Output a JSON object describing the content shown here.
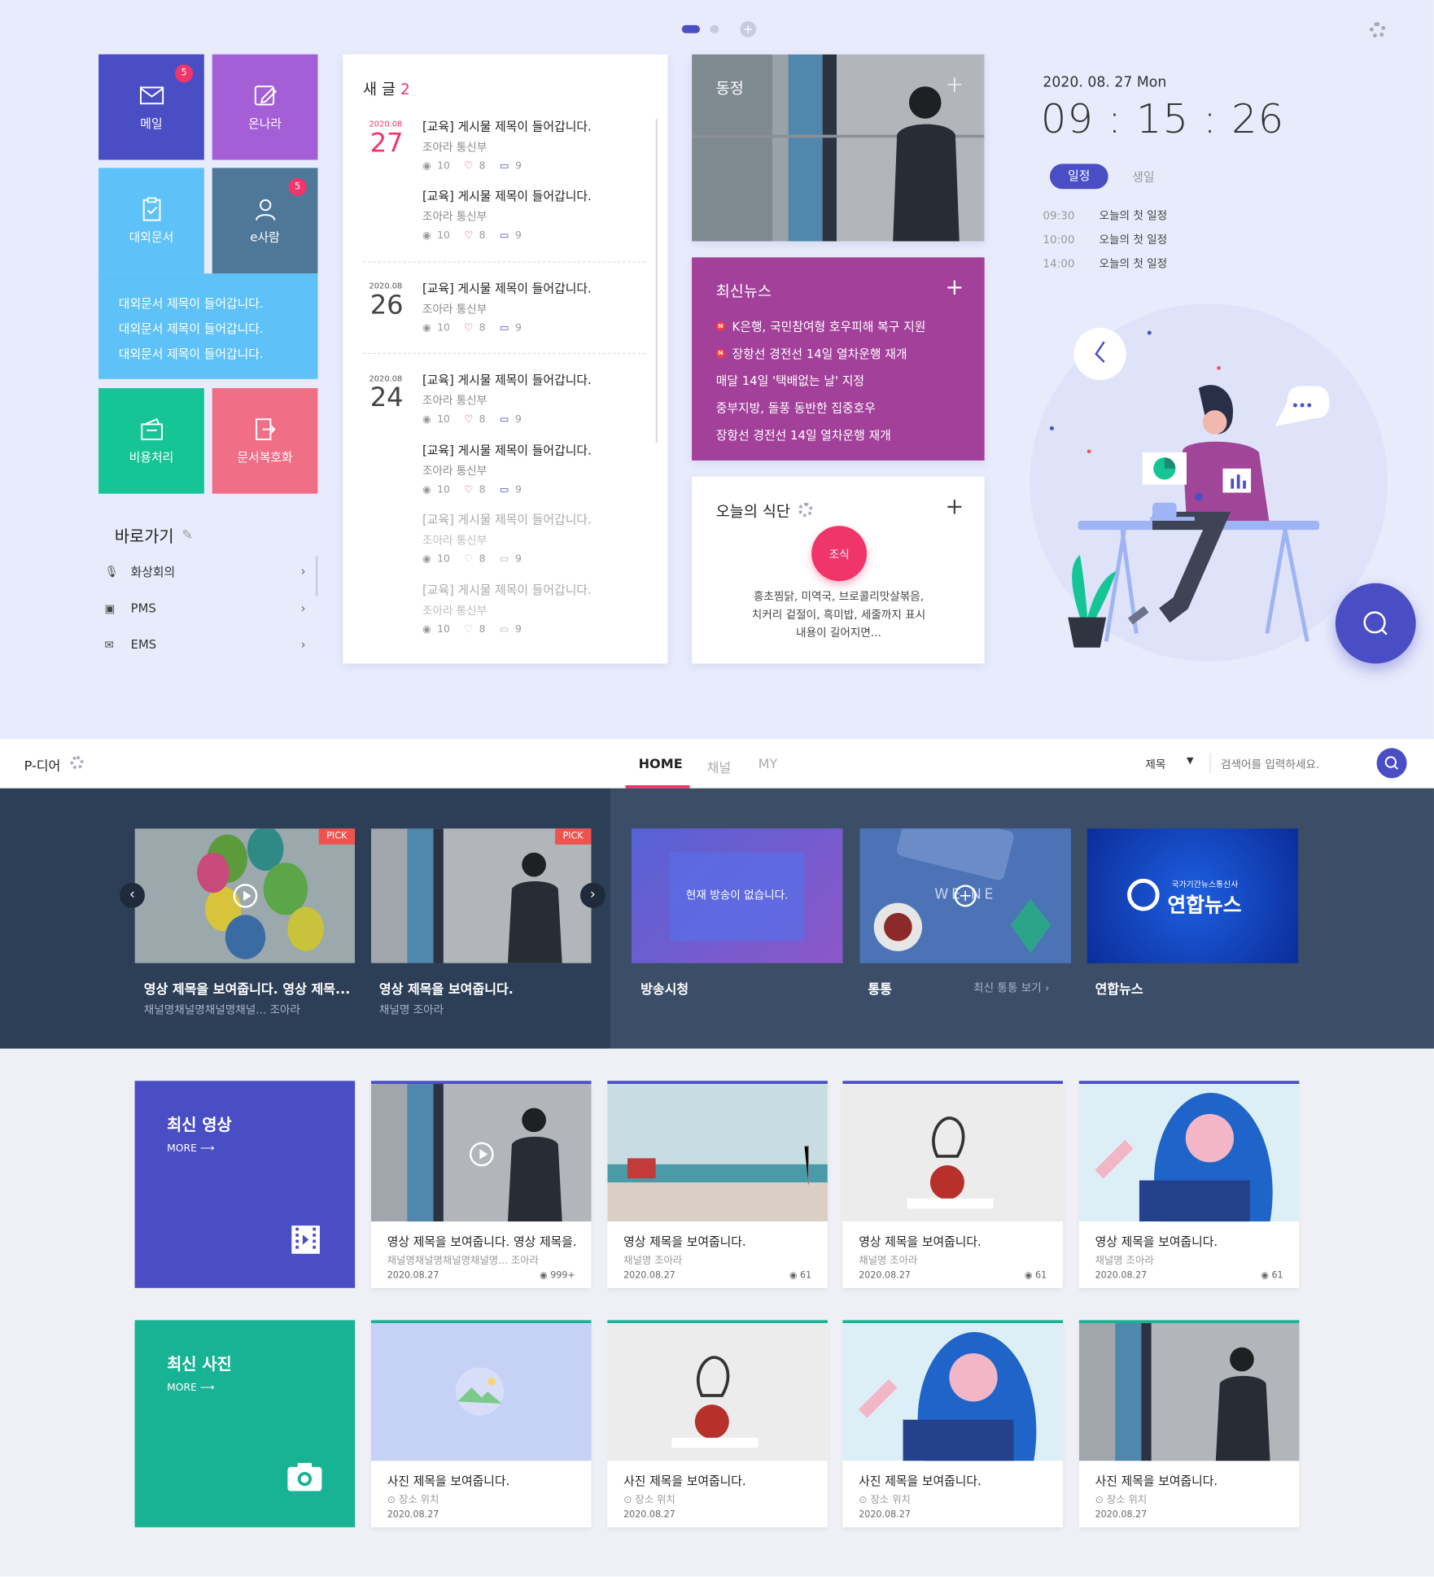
{
  "pager": {
    "dots": 3
  },
  "tiles": [
    {
      "label": "메일",
      "badge": "5",
      "color": "#4a4ec5"
    },
    {
      "label": "온나라",
      "color": "#a55fd6"
    },
    {
      "label": "대외문서",
      "color": "#5ec2f8"
    },
    {
      "label": "e사람",
      "badge": "5",
      "color": "#4f7898"
    },
    {
      "label": "비용처리",
      "color": "#16c596"
    },
    {
      "label": "문서복호화",
      "color": "#f06e86"
    }
  ],
  "external_docs": [
    "대외문서 제목이 들어갑니다.",
    "대외문서 제목이 들어갑니다.",
    "대외문서 제목이 들어갑니다."
  ],
  "shortcuts": {
    "title": "바로가기",
    "items": [
      "화상회의",
      "PMS",
      "EMS"
    ]
  },
  "new_posts": {
    "title": "새 글",
    "count": "2",
    "groups": [
      {
        "ym": "2020.08",
        "day": "27"
      },
      {
        "ym": "2020.08",
        "day": "26"
      },
      {
        "ym": "2020.08",
        "day": "24"
      }
    ],
    "post_title": "[교육] 게시물 제목이 들어갑니다.",
    "author": "조아라 통신부",
    "views": "10",
    "likes": "8",
    "comments": "9"
  },
  "dongjeong": {
    "title": "동정"
  },
  "news": {
    "title": "최신뉴스",
    "items": [
      "K은행, 국민참여형 호우피해 복구 지원",
      "장항선 경전선 14일 열차운행 재개",
      "매달 14일 '택배없는 날' 지정",
      "중부지방, 돌풍 동반한 집중호우",
      "장항선 경전선 14일 열차운행 재개"
    ],
    "new_badge": "N"
  },
  "meal": {
    "title": "오늘의 식단",
    "tag": "조식",
    "desc": [
      "흥초찜닭, 미역국, 브로콜리맛살볶음,",
      "치커리 겉절이, 흑미밥, 세줄까지 표시",
      "내용이 길어지면..."
    ]
  },
  "clock": {
    "date": "2020. 08. 27 Mon",
    "time": "09 : 15 : 26"
  },
  "schedule": {
    "tabs": [
      "일정",
      "생일"
    ],
    "items": [
      {
        "time": "09:30",
        "text": "오늘의 첫 일정"
      },
      {
        "time": "10:00",
        "text": "오늘의 첫 일정"
      },
      {
        "time": "14:00",
        "text": "오늘의 첫 일정"
      }
    ]
  },
  "pmedia": {
    "brand": "P-디어",
    "tabs": [
      "HOME",
      "채널",
      "MY"
    ],
    "search_filter": "제목",
    "search_placeholder": "검색어를 입력하세요.",
    "picks": [
      {
        "title": "영상 제목을 보여줍니다. 영상 제목...",
        "sub": "채널명채널명채널명채널...  조아라",
        "pick": "PICK"
      },
      {
        "title": "영상 제목을 보여줍니다.",
        "sub": "채널명 조아라",
        "pick": "PICK"
      }
    ],
    "channels": [
      {
        "title": "방송시청",
        "overlay": "현재 방송이 없습니다."
      },
      {
        "title": "통통",
        "link": "최신 통통 보기",
        "overlay": "WE   NE"
      },
      {
        "title": "연합뉴스",
        "overlay": "연합뉴스",
        "overlay_sub": "국가기간뉴스통신사"
      }
    ]
  },
  "videos": {
    "title": "최신 영상",
    "more": "MORE",
    "items": [
      {
        "title": "영상 제목을 보여줍니다. 영상 제목을...",
        "sub": "채널명채널명채널명채널명...  조아라",
        "date": "2020.08.27",
        "views": "999+"
      },
      {
        "title": "영상 제목을 보여줍니다.",
        "sub": "채널명 조아라",
        "date": "2020.08.27",
        "views": "61"
      },
      {
        "title": "영상 제목을 보여줍니다.",
        "sub": "채널명 조아라",
        "date": "2020.08.27",
        "views": "61"
      },
      {
        "title": "영상 제목을 보여줍니다.",
        "sub": "채널명 조아라",
        "date": "2020.08.27",
        "views": "61"
      }
    ]
  },
  "photos": {
    "title": "최신 사진",
    "more": "MORE",
    "items": [
      {
        "title": "사진 제목을 보여줍니다.",
        "sub": "장소 위치",
        "date": "2020.08.27"
      },
      {
        "title": "사진 제목을 보여줍니다.",
        "sub": "장소 위치",
        "date": "2020.08.27"
      },
      {
        "title": "사진 제목을 보여줍니다.",
        "sub": "장소 위치",
        "date": "2020.08.27"
      },
      {
        "title": "사진 제목을 보여줍니다.",
        "sub": "장소 위치",
        "date": "2020.08.27"
      }
    ]
  }
}
